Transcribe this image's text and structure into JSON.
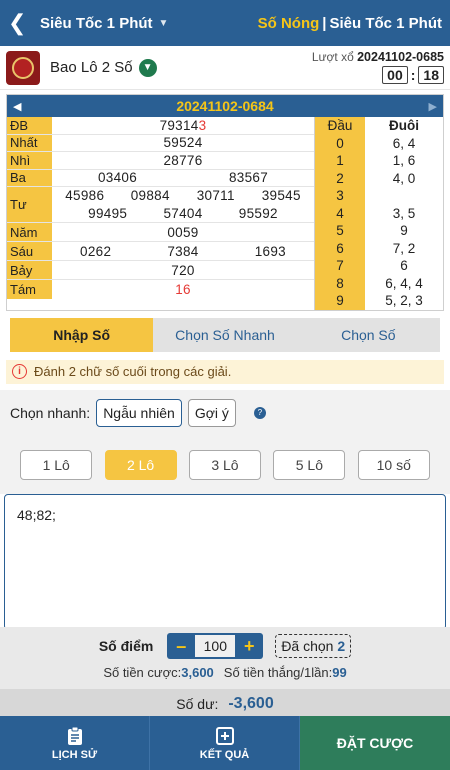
{
  "header": {
    "title": "Siêu Tốc 1 Phút",
    "hot_label": "Số Nóng",
    "separator": "|",
    "right_title": "Siêu Tốc 1 Phút"
  },
  "game": {
    "name": "Bao Lô 2 Số",
    "draw_label": "Lượt xổ",
    "draw_id": "20241102-0685",
    "countdown_min": "00",
    "countdown_sep": ":",
    "countdown_sec": "18"
  },
  "result": {
    "period": "20241102-0684",
    "prizes": [
      {
        "label": "ĐB",
        "values": [
          "79314",
          "3"
        ]
      },
      {
        "label": "Nhất",
        "values": [
          "59524"
        ]
      },
      {
        "label": "Nhì",
        "values": [
          "28776"
        ]
      },
      {
        "label": "Ba",
        "values": [
          "03406",
          "83567"
        ]
      },
      {
        "label": "Tư",
        "values": [
          "45986",
          "09884",
          "30711",
          "39545",
          "99495",
          "57404",
          "95592"
        ]
      },
      {
        "label": "Năm",
        "values": [
          "0059"
        ]
      },
      {
        "label": "Sáu",
        "values": [
          "0262",
          "7384",
          "1693"
        ]
      },
      {
        "label": "Bảy",
        "values": [
          "720"
        ]
      },
      {
        "label": "Tám",
        "values": [
          "16"
        ]
      }
    ],
    "head_label": "Đầu",
    "tail_label": "Đuôi",
    "heads": [
      {
        "d": "0",
        "t": "6, 4"
      },
      {
        "d": "1",
        "t": "1, 6"
      },
      {
        "d": "2",
        "t": "4, 0"
      },
      {
        "d": "3",
        "t": ""
      },
      {
        "d": "4",
        "t": "3, 5"
      },
      {
        "d": "5",
        "t": "9"
      },
      {
        "d": "6",
        "t": "7, 2"
      },
      {
        "d": "7",
        "t": "6"
      },
      {
        "d": "8",
        "t": "6, 4, 4"
      },
      {
        "d": "9",
        "t": "5, 2, 3"
      }
    ]
  },
  "tabs": [
    "Nhập Số",
    "Chọn Số Nhanh",
    "Chọn Số"
  ],
  "notice": "Đánh 2 chữ số cuối trong các giải.",
  "quick": {
    "label": "Chọn nhanh:",
    "random": "Ngẫu nhiên",
    "suggest": "Gợi ý"
  },
  "lo_options": [
    "1 Lô",
    "2 Lô",
    "3 Lô",
    "5 Lô",
    "10 số"
  ],
  "input_text": "48;82;",
  "bet": {
    "score_label": "Số điểm",
    "minus": "–",
    "plus": "+",
    "score_value": "100",
    "chosen_label": "Đã chọn",
    "chosen_count": "2",
    "stake_label": "Số tiền cược:",
    "stake_value": "3,600",
    "win_label": "Số tiền thắng/1lần:",
    "win_value": "99",
    "balance_label": "Số dư:",
    "balance_value": "-3,600"
  },
  "footer": {
    "history": "LỊCH SỬ",
    "results": "KẾT QUẢ",
    "place_bet": "ĐẶT CƯỢC"
  }
}
